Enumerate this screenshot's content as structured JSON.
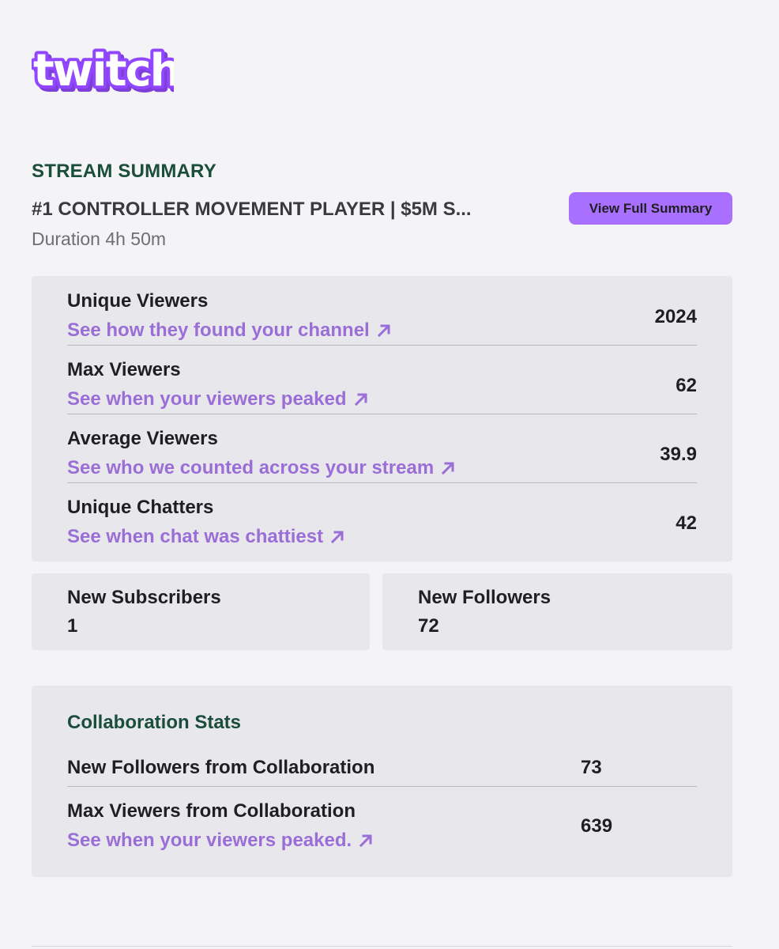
{
  "brand": {
    "logo_text": "twitch",
    "accent_color": "#a970ff",
    "link_color": "#9a6ed6",
    "heading_color": "#1a4d3a"
  },
  "header": {
    "section_title": "STREAM SUMMARY",
    "stream_title": "#1 CONTROLLER MOVEMENT PLAYER | $5M S...",
    "cta_label": "View Full Summary",
    "duration": "Duration 4h 50m"
  },
  "stats": [
    {
      "label": "Unique Viewers",
      "link": "See how they found your channel",
      "value": "2024",
      "icon": "arrow-up-right-icon"
    },
    {
      "label": "Max Viewers",
      "link": "See when your viewers peaked",
      "value": "62",
      "icon": "arrow-up-right-icon"
    },
    {
      "label": "Average Viewers",
      "link": "See who we counted across your stream",
      "value": "39.9",
      "icon": "arrow-up-right-icon"
    },
    {
      "label": "Unique Chatters",
      "link": "See when chat was chattiest",
      "value": "42",
      "icon": "arrow-up-right-icon"
    }
  ],
  "small_stats": [
    {
      "label": "New Subscribers",
      "value": "1"
    },
    {
      "label": "New Followers",
      "value": "72"
    }
  ],
  "collaboration": {
    "title": "Collaboration Stats",
    "rows": [
      {
        "label": "New Followers from Collaboration",
        "value": "73"
      },
      {
        "label": "Max Viewers from Collaboration",
        "link": "See when your viewers peaked.",
        "value": "639",
        "icon": "arrow-up-right-icon"
      }
    ]
  }
}
